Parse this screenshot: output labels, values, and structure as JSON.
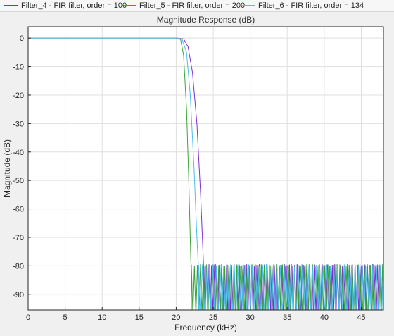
{
  "chart_data": {
    "type": "line",
    "title": "Magnitude Response (dB)",
    "xlabel": "Frequency (kHz)",
    "ylabel": "Magnitude (dB)",
    "xlim": [
      0,
      48
    ],
    "ylim": [
      -95.5,
      4
    ],
    "xticks": [
      0,
      5,
      10,
      15,
      20,
      25,
      30,
      35,
      40,
      45
    ],
    "yticks": [
      0,
      -10,
      -20,
      -30,
      -40,
      -50,
      -60,
      -70,
      -80,
      -90
    ],
    "grid": true,
    "legend_position": "top",
    "series": [
      {
        "name": "Filter_4 - FIR filter, order = 100",
        "color": "#7e2fd0",
        "passband_edge_khz": 20.0,
        "transition_points": [
          [
            20,
            0
          ],
          [
            21.0,
            -0.3
          ],
          [
            21.6,
            -3
          ],
          [
            22.2,
            -12
          ],
          [
            22.8,
            -30
          ],
          [
            23.3,
            -55
          ],
          [
            23.7,
            -80
          ],
          [
            23.75,
            -95.5
          ]
        ],
        "stopband_level_db": -80,
        "stopband_start_khz": 23.7
      },
      {
        "name": "Filter_5 - FIR filter, order = 200",
        "color": "#3aa337",
        "passband_edge_khz": 20.0,
        "transition_points": [
          [
            20,
            0
          ],
          [
            20.6,
            -0.5
          ],
          [
            21.0,
            -6
          ],
          [
            21.4,
            -25
          ],
          [
            21.7,
            -50
          ],
          [
            22.0,
            -80
          ],
          [
            22.05,
            -95.5
          ]
        ],
        "stopband_level_db": -80,
        "stopband_start_khz": 22.0
      },
      {
        "name": "Filter_6 - FIR filter, order = 134",
        "color": "#4dbeee",
        "passband_edge_khz": 20.0,
        "transition_points": [
          [
            20,
            0
          ],
          [
            20.8,
            -0.4
          ],
          [
            21.4,
            -5
          ],
          [
            21.9,
            -20
          ],
          [
            22.4,
            -45
          ],
          [
            22.8,
            -70
          ],
          [
            23.0,
            -80
          ],
          [
            23.05,
            -95.5
          ]
        ],
        "stopband_level_db": -80,
        "stopband_start_khz": 23.0
      }
    ]
  }
}
